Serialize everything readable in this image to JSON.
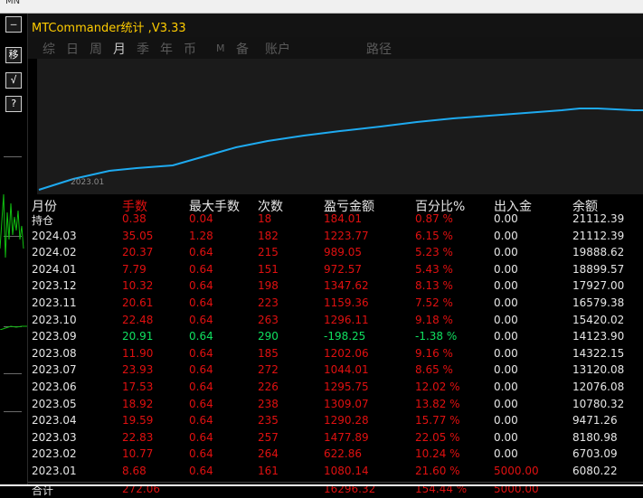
{
  "top_strip": {
    "label": "MN"
  },
  "left_toolbar": [
    {
      "label": "—",
      "icon": "minimize-icon"
    },
    {
      "label": "移",
      "icon": "move-icon"
    },
    {
      "label": "√",
      "icon": "check-icon"
    },
    {
      "label": "?",
      "icon": "help-icon"
    }
  ],
  "title": "MTCommander统计 ,V3.33",
  "tabs": [
    {
      "label": "综",
      "active": false
    },
    {
      "label": "日",
      "active": false
    },
    {
      "label": "周",
      "active": false
    },
    {
      "label": "月",
      "active": true
    },
    {
      "label": "季",
      "active": false
    },
    {
      "label": "年",
      "active": false
    },
    {
      "label": "币",
      "active": false
    },
    {
      "label": "M",
      "active": false
    },
    {
      "label": "备",
      "active": false
    },
    {
      "label": "账户",
      "active": false
    },
    {
      "label": "路径",
      "active": false
    }
  ],
  "chart": {
    "x_tick": "2023.01",
    "line_color": "#1eaaf0"
  },
  "table": {
    "headers": [
      "月份",
      "手数",
      "最大手数",
      "次数",
      "盈亏金额",
      "百分比%",
      "出入金",
      "余额"
    ],
    "rows": [
      {
        "month": "持仓",
        "lots": "0.38",
        "max_lots": "0.04",
        "count": "18",
        "pnl": "184.01",
        "pct": "0.87 %",
        "flow": "0.00",
        "balance": "21112.39",
        "color": "red"
      },
      {
        "month": "2024.03",
        "lots": "35.05",
        "max_lots": "1.28",
        "count": "182",
        "pnl": "1223.77",
        "pct": "6.15 %",
        "flow": "0.00",
        "balance": "21112.39",
        "color": "red"
      },
      {
        "month": "2024.02",
        "lots": "20.37",
        "max_lots": "0.64",
        "count": "215",
        "pnl": "989.05",
        "pct": "5.23 %",
        "flow": "0.00",
        "balance": "19888.62",
        "color": "red"
      },
      {
        "month": "2024.01",
        "lots": "7.79",
        "max_lots": "0.64",
        "count": "151",
        "pnl": "972.57",
        "pct": "5.43 %",
        "flow": "0.00",
        "balance": "18899.57",
        "color": "red"
      },
      {
        "month": "2023.12",
        "lots": "10.32",
        "max_lots": "0.64",
        "count": "198",
        "pnl": "1347.62",
        "pct": "8.13 %",
        "flow": "0.00",
        "balance": "17927.00",
        "color": "red"
      },
      {
        "month": "2023.11",
        "lots": "20.61",
        "max_lots": "0.64",
        "count": "223",
        "pnl": "1159.36",
        "pct": "7.52 %",
        "flow": "0.00",
        "balance": "16579.38",
        "color": "red"
      },
      {
        "month": "2023.10",
        "lots": "22.48",
        "max_lots": "0.64",
        "count": "263",
        "pnl": "1296.11",
        "pct": "9.18 %",
        "flow": "0.00",
        "balance": "15420.02",
        "color": "red"
      },
      {
        "month": "2023.09",
        "lots": "20.91",
        "max_lots": "0.64",
        "count": "290",
        "pnl": "-198.25",
        "pct": "-1.38 %",
        "flow": "0.00",
        "balance": "14123.90",
        "color": "green"
      },
      {
        "month": "2023.08",
        "lots": "11.90",
        "max_lots": "0.64",
        "count": "185",
        "pnl": "1202.06",
        "pct": "9.16 %",
        "flow": "0.00",
        "balance": "14322.15",
        "color": "red"
      },
      {
        "month": "2023.07",
        "lots": "23.93",
        "max_lots": "0.64",
        "count": "272",
        "pnl": "1044.01",
        "pct": "8.65 %",
        "flow": "0.00",
        "balance": "13120.08",
        "color": "red"
      },
      {
        "month": "2023.06",
        "lots": "17.53",
        "max_lots": "0.64",
        "count": "226",
        "pnl": "1295.75",
        "pct": "12.02 %",
        "flow": "0.00",
        "balance": "12076.08",
        "color": "red"
      },
      {
        "month": "2023.05",
        "lots": "18.92",
        "max_lots": "0.64",
        "count": "238",
        "pnl": "1309.07",
        "pct": "13.82 %",
        "flow": "0.00",
        "balance": "10780.32",
        "color": "red"
      },
      {
        "month": "2023.04",
        "lots": "19.59",
        "max_lots": "0.64",
        "count": "235",
        "pnl": "1290.28",
        "pct": "15.77 %",
        "flow": "0.00",
        "balance": "9471.26",
        "color": "red"
      },
      {
        "month": "2023.03",
        "lots": "22.83",
        "max_lots": "0.64",
        "count": "257",
        "pnl": "1477.89",
        "pct": "22.05 %",
        "flow": "0.00",
        "balance": "8180.98",
        "color": "red"
      },
      {
        "month": "2023.02",
        "lots": "10.77",
        "max_lots": "0.64",
        "count": "264",
        "pnl": "622.86",
        "pct": "10.24 %",
        "flow": "0.00",
        "balance": "6703.09",
        "color": "red"
      },
      {
        "month": "2023.01",
        "lots": "8.68",
        "max_lots": "0.64",
        "count": "161",
        "pnl": "1080.14",
        "pct": "21.60 %",
        "flow": "5000.00",
        "balance": "6080.22",
        "color": "red"
      }
    ],
    "total": {
      "month": "合计",
      "lots": "272.06",
      "pnl": "16296.32",
      "pct": "154.44 %",
      "flow": "5000.00"
    }
  }
}
